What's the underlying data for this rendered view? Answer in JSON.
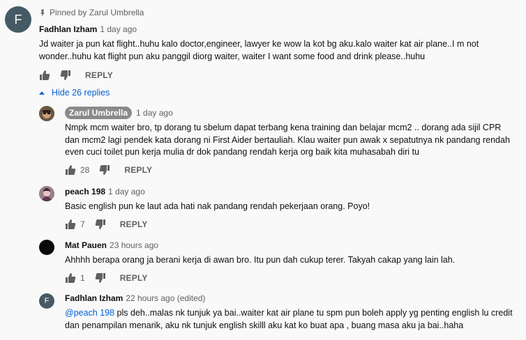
{
  "pinned": {
    "text": "Pinned by Zarul Umbrella"
  },
  "top_comment": {
    "avatar_letter": "F",
    "author": "Fadhlan Izham",
    "time": "1 day ago",
    "lines": [
      "Jd waiter ja pun kat flight..huhu kalo doctor,engineer,  lawyer ke wow la kot bg aku.kalo waiter kat air plane..I m not",
      "wonder..huhu kat flight pun aku panggil diorg waiter, waiter I want some food and drink please..huhu"
    ],
    "reply_label": "REPLY"
  },
  "hide_replies": {
    "label": "Hide 26 replies"
  },
  "replies": [
    {
      "author": "Zarul Umbrella",
      "time": "1 day ago",
      "is_creator": true,
      "lines": [
        "Nmpk mcm waiter bro, tp dorang tu sbelum dapat terbang kena training dan belajar mcm2 .. dorang ada sijil CPR",
        "dan mcm2 lagi pendek kata dorang ni First Aider bertauliah. Klau waiter pun awak x sepatutnya nk pandang rendah",
        "even cuci toilet pun kerja mulia dr dok pandang rendah kerja org baik kita muhasabah diri tu"
      ],
      "likes": "28",
      "reply_label": "REPLY"
    },
    {
      "author": "peach 198",
      "time": "1 day ago",
      "lines": [
        "Basic english pun ke laut ada hati nak pandang rendah pekerjaan orang. Poyo!"
      ],
      "likes": "7",
      "reply_label": "REPLY"
    },
    {
      "author": "Mat Pauen",
      "time": "23 hours ago",
      "lines": [
        "Ahhhh berapa orang ja berani kerja di awan bro. Itu pun dah cukup terer. Takyah cakap yang lain lah."
      ],
      "likes": "1",
      "reply_label": "REPLY"
    },
    {
      "avatar_letter": "F",
      "author": "Fadhlan Izham",
      "time": "22 hours ago (edited)",
      "mention": "@peach 198",
      "line1_rest": " pls deh..malas nk tunjuk ya bai..waiter kat air plane tu spm pun boleh apply yg penting english lu credit",
      "line2": "dan penampilan menarik, aku nk tunjuk english skilll aku kat ko buat apa , buang masa aku ja bai..haha"
    }
  ],
  "colors": {
    "background": "#f9f9f9",
    "link": "#065fd4",
    "avatar_f": "#455a64",
    "creator_badge": "#8a8a8a"
  }
}
